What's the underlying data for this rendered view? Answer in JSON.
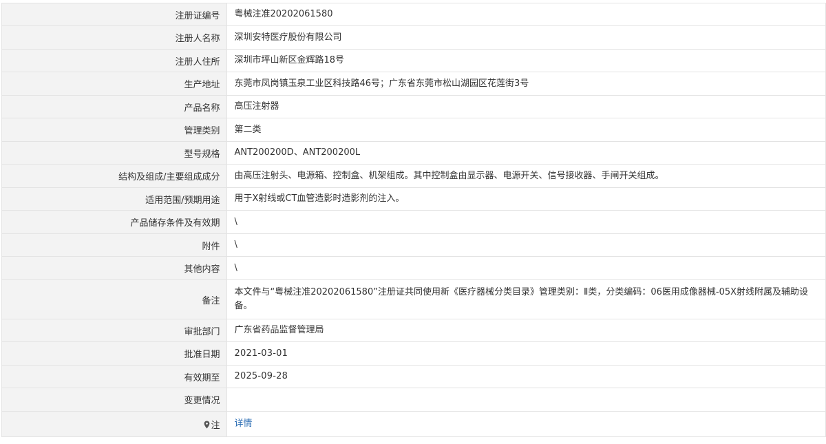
{
  "rows": [
    {
      "label": "注册证编号",
      "value": "粤械注准20202061580"
    },
    {
      "label": "注册人名称",
      "value": "深圳安特医疗股份有限公司"
    },
    {
      "label": "注册人住所",
      "value": "深圳市坪山新区金辉路18号"
    },
    {
      "label": "生产地址",
      "value": "东莞市凤岗镇玉泉工业区科技路46号；广东省东莞市松山湖园区花莲街3号"
    },
    {
      "label": "产品名称",
      "value": "高压注射器"
    },
    {
      "label": "管理类别",
      "value": "第二类"
    },
    {
      "label": "型号规格",
      "value": "ANT200200D、ANT200200L"
    },
    {
      "label": "结构及组成/主要组成成分",
      "value": "由高压注射头、电源箱、控制盒、机架组成。其中控制盒由显示器、电源开关、信号接收器、手闸开关组成。"
    },
    {
      "label": "适用范围/预期用途",
      "value": "用于X射线或CT血管造影时造影剂的注入。"
    },
    {
      "label": "产品储存条件及有效期",
      "value": "\\"
    },
    {
      "label": "附件",
      "value": "\\"
    },
    {
      "label": "其他内容",
      "value": "\\"
    },
    {
      "label": "备注",
      "value": "本文件与“粤械注准20202061580”注册证共同使用新《医疗器械分类目录》管理类别：Ⅱ类，分类编码：06医用成像器械-05X射线附属及辅助设备。"
    },
    {
      "label": "审批部门",
      "value": "广东省药品监督管理局"
    },
    {
      "label": "批准日期",
      "value": "2021-03-01"
    },
    {
      "label": "有效期至",
      "value": "2025-09-28"
    },
    {
      "label": "变更情况",
      "value": ""
    }
  ],
  "note_row": {
    "label": "注",
    "link_text": "详情",
    "icon": "map-pin-icon"
  },
  "colors": {
    "label_bg": "#f3f3f3",
    "border": "#e3e3e3",
    "text": "#333333",
    "link": "#2a6cb3"
  }
}
